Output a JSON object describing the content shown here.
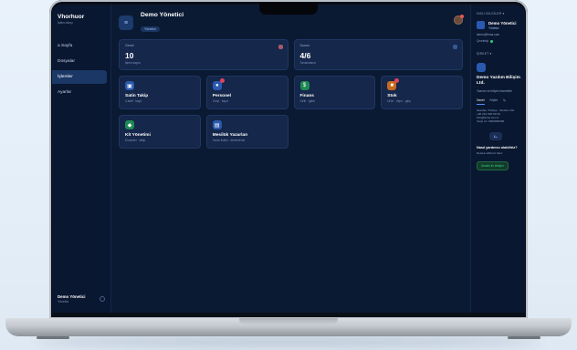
{
  "sidebar": {
    "brand_name": "Vhorhuor",
    "brand_sub": "İşlem akışı",
    "items": [
      {
        "label": "a Sayfa",
        "active": false
      },
      {
        "label": "Dosyalar",
        "active": false
      },
      {
        "label": "İşlemler",
        "active": true
      },
      {
        "label": "Ayarlar",
        "active": false
      }
    ],
    "user_name": "Demo Yönetici",
    "user_role": "Yönetici"
  },
  "topbar": {
    "title": "Demo Yönetici",
    "badge": "Yönetici"
  },
  "stats": [
    {
      "label": "Genel",
      "value": "10",
      "sub": "İşlem sayısı"
    },
    {
      "label": "Durum",
      "value": "4/6",
      "sub": "Tamamlandı"
    }
  ],
  "cards": [
    {
      "title": "Satin Takip",
      "sub": "4 aktif · kayıt",
      "icon": "cart-icon",
      "color": "blue",
      "badge": false
    },
    {
      "title": "Personel",
      "sub": "3 kişi · kayıt",
      "icon": "people-icon",
      "color": "blue",
      "badge": true
    },
    {
      "title": "Finans",
      "sub": "Gelir · gider",
      "icon": "money-icon",
      "color": "green",
      "badge": false
    },
    {
      "title": "Stok",
      "sub": "Ürün · depo · giriş",
      "icon": "box-icon",
      "color": "orange",
      "badge": true
    },
    {
      "title": "Kit Yönetimi",
      "sub": "Envanter · takip",
      "icon": "kit-icon",
      "color": "green",
      "badge": false
    },
    {
      "title": "Mesilük Yazarları",
      "sub": "Yazar listesi · düzenleme",
      "icon": "book-icon",
      "color": "blue",
      "badge": false
    }
  ],
  "rpanel": {
    "section1": "HIZLI BİLGİLER ▾",
    "profile_name": "Demo Yönetici",
    "profile_tag": "Yönetici",
    "lines": [
      "demo@firma.com",
      "Çevrimiçi"
    ],
    "section2": "ŞİRKET ▾",
    "company_name": "Demo Yazılım Bilişim Ltd.",
    "company_desc": "Yazılım ve bilişim hizmetleri",
    "tabs": [
      "Genel",
      "Kişiler",
      "İş"
    ],
    "info": [
      "İstanbul, Türkiye · Merkez ofis",
      "+90 212 000 00 00",
      "info@firma.com.tr",
      "Vergi no: 0000000000"
    ],
    "help_title": "Nasıl yardımcı olabiliriz?",
    "help_sub": "Destek ekibimiz hazır",
    "help_button": "Destek ile iletişim"
  }
}
